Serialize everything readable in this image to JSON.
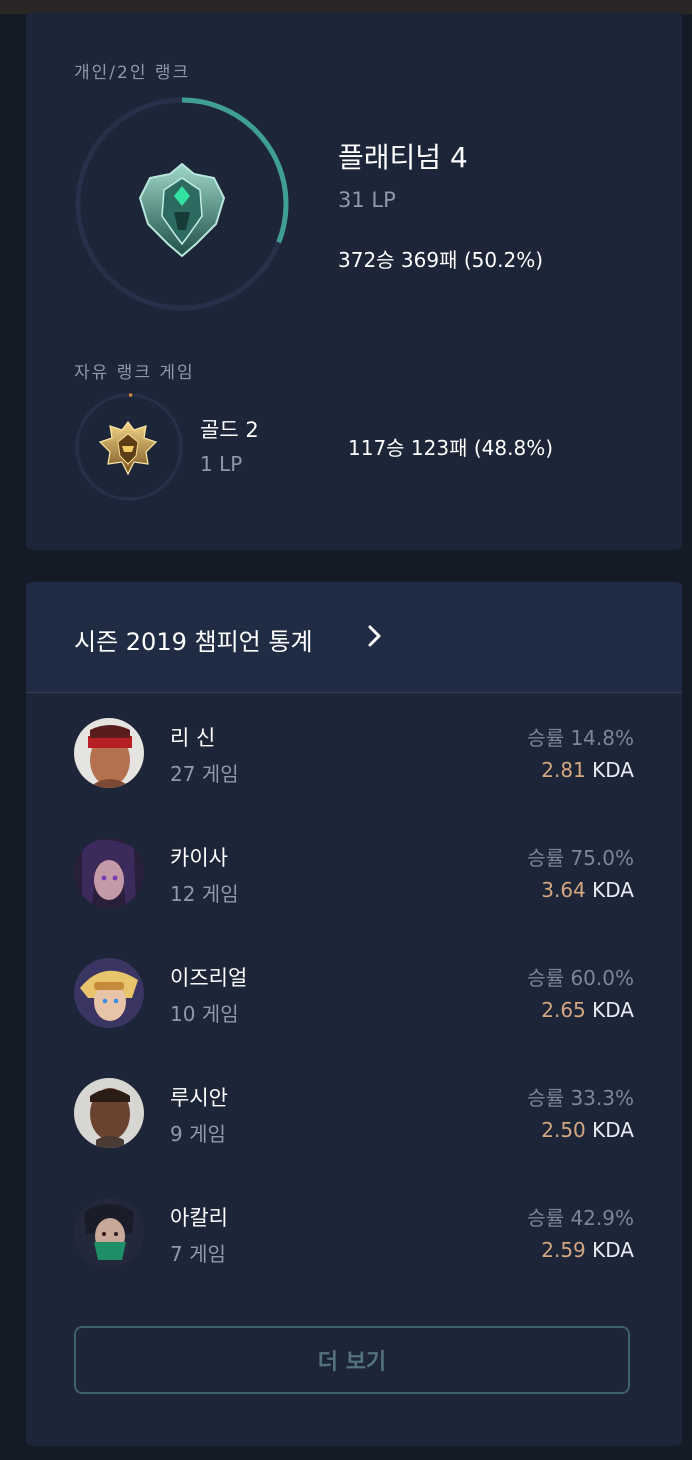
{
  "solo": {
    "label": "개인/2인 랭크",
    "tier": "플래티넘 4",
    "lp": "31 LP",
    "record": "372승 369패 (50.2%)",
    "lp_progress": 0.31,
    "emblem_icon": "platinum-emblem-icon",
    "accent": "#3f9f92"
  },
  "flex": {
    "label": "자유 랭크 게임",
    "tier": "골드 2",
    "lp": "1 LP",
    "record": "117승 123패 (48.8%)",
    "lp_progress": 0.01,
    "emblem_icon": "gold-emblem-icon",
    "accent": "#e0883a"
  },
  "stats": {
    "title": "시즌 2019 챔피언 통계",
    "arrow_icon": "chevron-right-icon",
    "champions": [
      {
        "name": "리 신",
        "games": "27 게임",
        "winrate": "승률 14.8%",
        "kda_value": "2.81",
        "kda_unit": "KDA"
      },
      {
        "name": "카이사",
        "games": "12 게임",
        "winrate": "승률 75.0%",
        "kda_value": "3.64",
        "kda_unit": "KDA"
      },
      {
        "name": "이즈리얼",
        "games": "10 게임",
        "winrate": "승률 60.0%",
        "kda_value": "2.65",
        "kda_unit": "KDA"
      },
      {
        "name": "루시안",
        "games": "9 게임",
        "winrate": "승률 33.3%",
        "kda_value": "2.50",
        "kda_unit": "KDA"
      },
      {
        "name": "아칼리",
        "games": "7 게임",
        "winrate": "승률 42.9%",
        "kda_value": "2.59",
        "kda_unit": "KDA"
      }
    ],
    "more_label": "더 보기"
  },
  "colors": {
    "background": "#141b26",
    "card": "#1d2538",
    "kda": "#d4a781",
    "muted_text": "#8e99ab"
  }
}
